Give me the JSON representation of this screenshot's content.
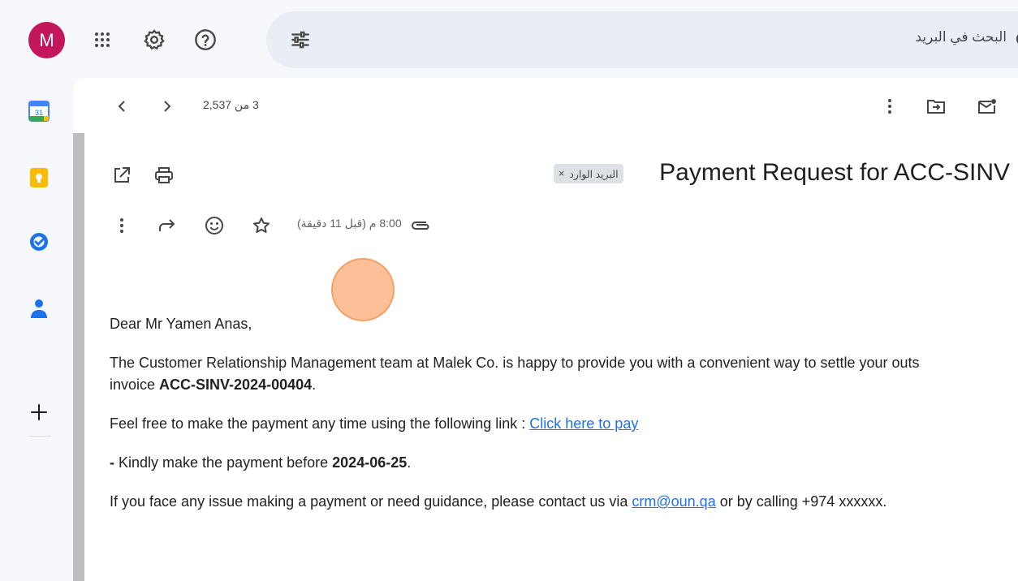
{
  "account": {
    "initial": "M",
    "color": "#c2185b"
  },
  "search": {
    "placeholder": "البحث في البريد"
  },
  "header": {
    "apps_icon": "apps-grid-icon",
    "settings_icon": "gear-icon",
    "help_icon": "help-icon",
    "filter_icon": "tune-icon"
  },
  "rail": {
    "calendar_day": "31",
    "items": [
      "calendar",
      "keep",
      "tasks",
      "contacts",
      "add"
    ]
  },
  "message_toolbar": {
    "counter": "3 من 2,537"
  },
  "email": {
    "subject": "Payment Request for ACC-SINV",
    "label": "البريد الوارد",
    "time": "8:00 م (قبل 11 دقيقة)",
    "greeting": "Dear Mr Yamen Anas,",
    "para1_line1": "The Customer Relationship Management team at Malek Co. is happy to provide you with a convenient way to settle your outs",
    "para1_prefix": "invoice ",
    "invoice_no": "ACC-SINV-2024-00404",
    "para1_suffix": ".",
    "para2_prefix": "Feel free to make the payment any time using the following link : ",
    "pay_link": "Click here to pay",
    "para3_dash": "-",
    "para3_text": " Kindly make the payment before ",
    "due_date": "2024-06-25",
    "para3_suffix": ".",
    "para4_prefix": "If you face any issue making a payment or need guidance, please contact us via ",
    "contact_email": "crm@oun.qa",
    "para4_suffix": " or by calling +974 xxxxxx."
  },
  "colors": {
    "link": "#1a73e8",
    "accent_cursor": "#fba56c",
    "background": "#f6f8fc"
  }
}
